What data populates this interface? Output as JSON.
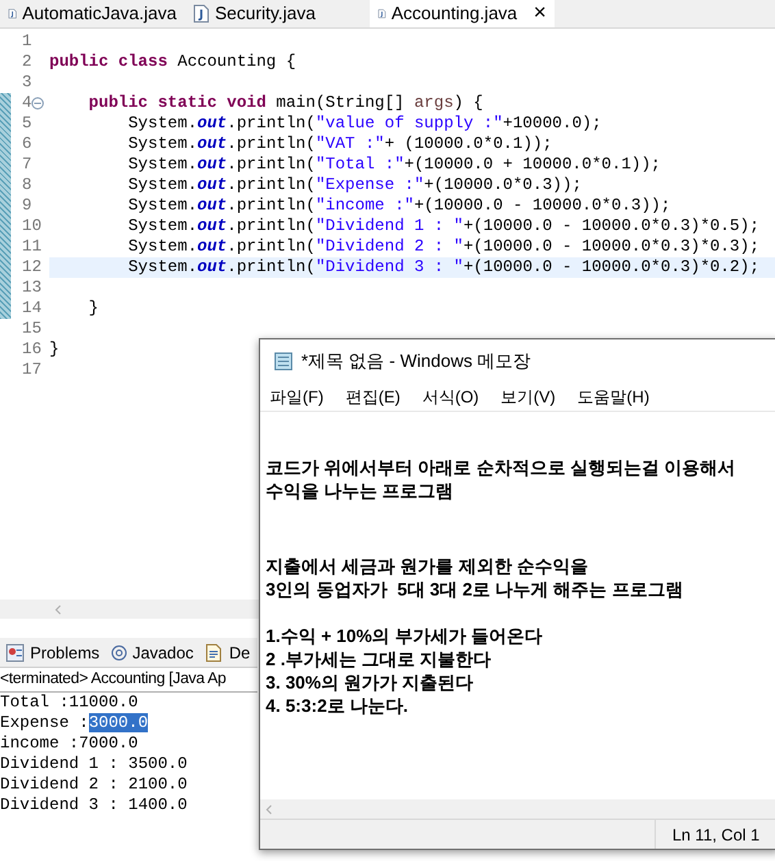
{
  "editor_tabs": [
    {
      "label": "AutomaticJava.java",
      "selected": false
    },
    {
      "label": "Security.java",
      "selected": false
    },
    {
      "label": "Accounting.java",
      "selected": true,
      "close": "×"
    }
  ],
  "code_lines": [
    {
      "number": "1"
    },
    {
      "number": "2",
      "tokens": [
        {
          "kind": "keyword",
          "text": "public class"
        },
        {
          "kind": "plain",
          "text": " Accounting {"
        }
      ]
    },
    {
      "number": "3"
    },
    {
      "number": "4",
      "fold": true,
      "tokens": [
        {
          "kind": "keyword",
          "text": "    public static void"
        },
        {
          "kind": "plain",
          "text": " main(String[] "
        },
        {
          "kind": "param",
          "text": "args"
        },
        {
          "kind": "plain",
          "text": ") {"
        }
      ]
    },
    {
      "number": "5",
      "tokens": [
        {
          "kind": "plain",
          "text": "        System."
        },
        {
          "kind": "field",
          "text": "out"
        },
        {
          "kind": "plain",
          "text": ".println("
        },
        {
          "kind": "string",
          "text": "\"value of supply :\""
        },
        {
          "kind": "plain",
          "text": "+10000.0);"
        }
      ]
    },
    {
      "number": "6",
      "tokens": [
        {
          "kind": "plain",
          "text": "        System."
        },
        {
          "kind": "field",
          "text": "out"
        },
        {
          "kind": "plain",
          "text": ".println("
        },
        {
          "kind": "string",
          "text": "\"VAT :\""
        },
        {
          "kind": "plain",
          "text": "+ (10000.0*0.1));"
        }
      ]
    },
    {
      "number": "7",
      "tokens": [
        {
          "kind": "plain",
          "text": "        System."
        },
        {
          "kind": "field",
          "text": "out"
        },
        {
          "kind": "plain",
          "text": ".println("
        },
        {
          "kind": "string",
          "text": "\"Total :\""
        },
        {
          "kind": "plain",
          "text": "+(10000.0 + 10000.0*0.1));"
        }
      ]
    },
    {
      "number": "8",
      "tokens": [
        {
          "kind": "plain",
          "text": "        System."
        },
        {
          "kind": "field",
          "text": "out"
        },
        {
          "kind": "plain",
          "text": ".println("
        },
        {
          "kind": "string",
          "text": "\"Expense :\""
        },
        {
          "kind": "plain",
          "text": "+(10000.0*0.3));"
        }
      ]
    },
    {
      "number": "9",
      "tokens": [
        {
          "kind": "plain",
          "text": "        System."
        },
        {
          "kind": "field",
          "text": "out"
        },
        {
          "kind": "plain",
          "text": ".println("
        },
        {
          "kind": "string",
          "text": "\"income :\""
        },
        {
          "kind": "plain",
          "text": "+(10000.0 - 10000.0*0.3));"
        }
      ]
    },
    {
      "number": "10",
      "tokens": [
        {
          "kind": "plain",
          "text": "        System."
        },
        {
          "kind": "field",
          "text": "out"
        },
        {
          "kind": "plain",
          "text": ".println("
        },
        {
          "kind": "string",
          "text": "\"Dividend 1 : \""
        },
        {
          "kind": "plain",
          "text": "+(10000.0 - 10000.0*0.3)*0.5);"
        }
      ]
    },
    {
      "number": "11",
      "tokens": [
        {
          "kind": "plain",
          "text": "        System."
        },
        {
          "kind": "field",
          "text": "out"
        },
        {
          "kind": "plain",
          "text": ".println("
        },
        {
          "kind": "string",
          "text": "\"Dividend 2 : \""
        },
        {
          "kind": "plain",
          "text": "+(10000.0 - 10000.0*0.3)*0.3);"
        }
      ]
    },
    {
      "number": "12",
      "current": true,
      "tokens": [
        {
          "kind": "plain",
          "text": "        System."
        },
        {
          "kind": "field",
          "text": "out"
        },
        {
          "kind": "plain",
          "text": ".println("
        },
        {
          "kind": "string",
          "text": "\"Dividend 3 : \""
        },
        {
          "kind": "plain",
          "text": "+(10000.0 - 10000.0*0.3)*0.2);"
        }
      ]
    },
    {
      "number": "13"
    },
    {
      "number": "14",
      "tokens": [
        {
          "kind": "plain",
          "text": "    }"
        }
      ]
    },
    {
      "number": "15"
    },
    {
      "number": "16",
      "tokens": [
        {
          "kind": "plain",
          "text": "}"
        }
      ]
    },
    {
      "number": "17"
    }
  ],
  "view_tabs": [
    {
      "label": "Problems"
    },
    {
      "label": "Javadoc"
    },
    {
      "label": "De"
    }
  ],
  "console_header": "<terminated> Accounting [Java Ap",
  "console_lines": [
    [
      {
        "text": "Total :11000.0",
        "selected": false
      }
    ],
    [
      {
        "text": "Expense :",
        "selected": false
      },
      {
        "text": "3000.0",
        "selected": true
      }
    ],
    [
      {
        "text": "income :7000.0",
        "selected": false
      }
    ],
    [
      {
        "text": "Dividend 1 : 3500.0",
        "selected": false
      }
    ],
    [
      {
        "text": "Dividend 2 : 2100.0",
        "selected": false
      }
    ],
    [
      {
        "text": "Dividend 3 : 1400.0",
        "selected": false
      }
    ]
  ],
  "notepad": {
    "title": "*제목 없음 - Windows 메모장",
    "menu": [
      "파일(F)",
      "편집(E)",
      "서식(O)",
      "보기(V)",
      "도움말(H)"
    ],
    "paragraphs": [
      [
        "코드가 위에서부터 아래로 순차적으로 실행되는걸 이용해서",
        "수익을 나누는 프로그램"
      ],
      [
        "지출에서 세금과 원가를 제외한 순수익을",
        "3인의 동업자가  5대 3대 2로 나누게 해주는 프로그램"
      ],
      [
        "1.수익 + 10%의 부가세가 들어온다",
        "2 .부가세는 그대로 지불한다",
        "3. 30%의 원가가 지출된다",
        "4. 5:3:2로 나눈다."
      ]
    ],
    "status": "Ln 11, Col 1"
  }
}
